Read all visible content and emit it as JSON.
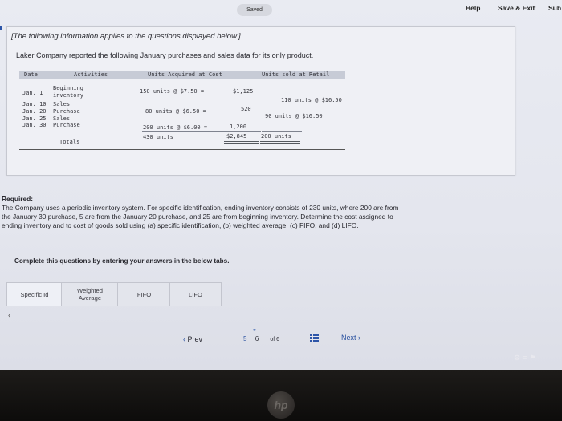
{
  "header": {
    "saved_label": "Saved",
    "help_label": "Help",
    "save_exit_label": "Save & Exit",
    "submit_label": "Sub"
  },
  "intro": {
    "applies": "[The following information applies to the questions displayed below.]",
    "description": "Laker Company reported the following January purchases and sales data for its only product."
  },
  "table": {
    "headers": {
      "date": "Date",
      "activities": "Activities",
      "cost": "Units Acquired at Cost",
      "retail": "Units sold at Retail"
    },
    "rows": [
      {
        "date": "Jan. 1",
        "activity": "Beginning",
        "activity2": "inventory",
        "acq": "150 units @ $7.50 =",
        "cost": "$1,125",
        "sold": ""
      },
      {
        "date": "Jan. 10",
        "activity": "Sales",
        "acq": "",
        "cost": "",
        "sold": "110 units @ $16.50"
      },
      {
        "date": "Jan. 20",
        "activity": "Purchase",
        "acq": "80 units @ $6.50 =",
        "cost": "520",
        "sold": ""
      },
      {
        "date": "Jan. 25",
        "activity": "Sales",
        "acq": "",
        "cost": "",
        "sold": "90 units @ $16.50"
      },
      {
        "date": "Jan. 30",
        "activity": "Purchase",
        "acq": "200 units @ $6.00 =",
        "cost": "1,200",
        "sold": ""
      },
      {
        "date": "",
        "activity": "Totals",
        "acq": "430 units",
        "cost": "$2,845",
        "sold": "200 units"
      }
    ]
  },
  "required": {
    "heading": "Required:",
    "line1": "The Company uses a periodic inventory system. For specific identification, ending inventory consists of 230 units, where 200 are from",
    "line2": "the January 30 purchase, 5 are from the January 20 purchase, and 25 are from beginning inventory. Determine the cost assigned to",
    "line3": "ending inventory and to cost of goods sold using (a) specific identification, (b) weighted average, (c) FIFO, and (d) LIFO."
  },
  "instruction": "Complete this questions by entering your answers in the below tabs.",
  "tabs": [
    {
      "line1": "Specific Id",
      "line2": ""
    },
    {
      "line1": "Weighted",
      "line2": "Average"
    },
    {
      "line1": "FIFO",
      "line2": ""
    },
    {
      "line1": "LIFO",
      "line2": ""
    }
  ],
  "navigation": {
    "prev_label": "Prev",
    "current_page": "5",
    "page_number": "6",
    "of_label": "of 6",
    "next_label": "Next"
  },
  "logo_text": "hp",
  "accent_color": "#2d55a8"
}
